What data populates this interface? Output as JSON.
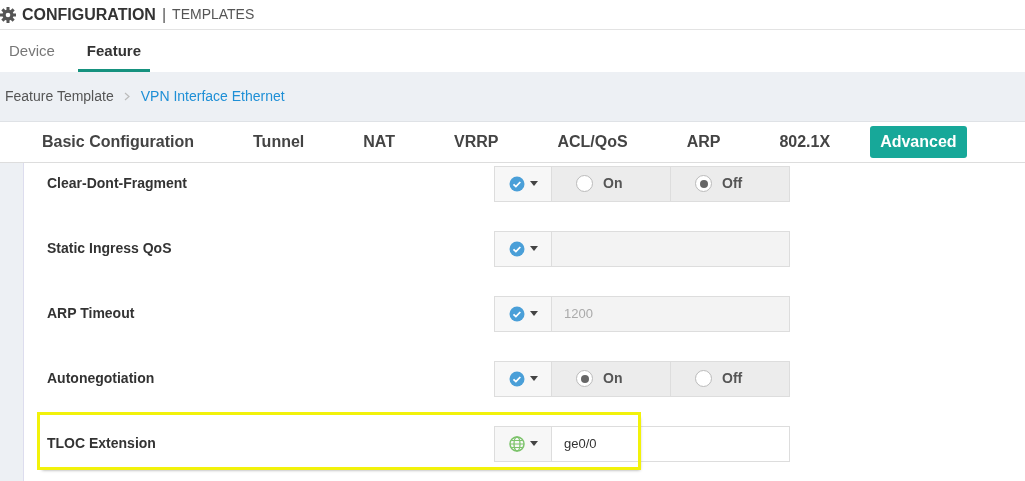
{
  "header": {
    "title": "CONFIGURATION",
    "separator": "|",
    "subtitle": "TEMPLATES"
  },
  "tabs": [
    {
      "label": "Device",
      "selected": false
    },
    {
      "label": "Feature",
      "selected": true
    }
  ],
  "breadcrumb": [
    {
      "label": "Feature Template",
      "current": false
    },
    {
      "label": "VPN Interface Ethernet",
      "current": true
    }
  ],
  "sections": [
    {
      "label": "Basic Configuration",
      "selected": false
    },
    {
      "label": "Tunnel",
      "selected": false
    },
    {
      "label": "NAT",
      "selected": false
    },
    {
      "label": "VRRP",
      "selected": false
    },
    {
      "label": "ACL/QoS",
      "selected": false
    },
    {
      "label": "ARP",
      "selected": false
    },
    {
      "label": "802.1X",
      "selected": false
    },
    {
      "label": "Advanced",
      "selected": true
    }
  ],
  "fields": [
    {
      "label": "Clear-Dont-Fragment",
      "global": false,
      "kind": "radio",
      "options": [
        {
          "label": "On",
          "selected": false
        },
        {
          "label": "Off",
          "selected": true
        }
      ],
      "highlighted": false
    },
    {
      "label": "Static Ingress QoS",
      "global": false,
      "kind": "text",
      "highlighted": false
    },
    {
      "label": "ARP Timeout",
      "global": false,
      "kind": "text",
      "placeholder": "1200",
      "highlighted": false
    },
    {
      "label": "Autonegotiation",
      "global": false,
      "kind": "radio",
      "options": [
        {
          "label": "On",
          "selected": true
        },
        {
          "label": "Off",
          "selected": false
        }
      ],
      "highlighted": false
    },
    {
      "label": "TLOC Extension",
      "global": true,
      "kind": "text",
      "value": "ge0/0",
      "highlighted": true
    }
  ]
}
